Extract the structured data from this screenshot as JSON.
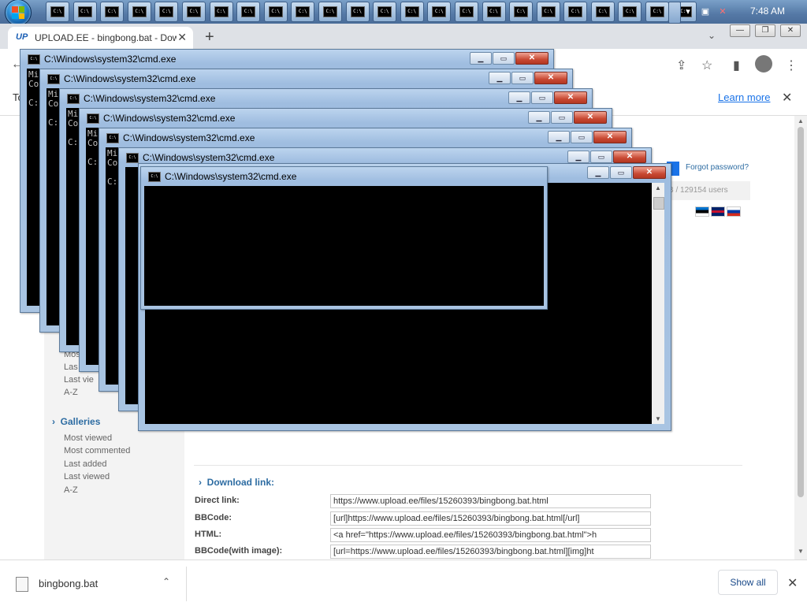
{
  "taskbar": {
    "button_count": 24,
    "cmd_icon_label": "C:\\",
    "clock": "7:48 AM"
  },
  "browser": {
    "tab_title": "UPLOAD.EE - bingbong.bat - Dow",
    "tab_favicon": "UP",
    "new_tab": "+",
    "infobar_lead": "To",
    "learn_more": "Learn more"
  },
  "site": {
    "forgot_password": "Forgot password?",
    "stats": "B  /  129154 users",
    "sidebar_links_top": [
      "Mos",
      "Las",
      "Last vie",
      "A-Z"
    ],
    "galleries": "Galleries",
    "gallery_links": [
      "Most viewed",
      "Most commented",
      "Last added",
      "Last viewed",
      "A-Z"
    ],
    "download_link_title": "Download link:",
    "links": [
      {
        "label": "Direct link:",
        "value": "https://www.upload.ee/files/15260393/bingbong.bat.html"
      },
      {
        "label": "BBCode:",
        "value": "[url]https://www.upload.ee/files/15260393/bingbong.bat.html[/url]"
      },
      {
        "label": "HTML:",
        "value": "<a href=\"https://www.upload.ee/files/15260393/bingbong.bat.html\">h"
      },
      {
        "label": "BBCode(with image):",
        "value": "[url=https://www.upload.ee/files/15260393/bingbong.bat.html][img]ht"
      }
    ]
  },
  "cmd": {
    "title": "C:\\Windows\\system32\\cmd.exe",
    "line1": "Mi",
    "line2": "Co",
    "prompt": "C:"
  },
  "download_shelf": {
    "filename": "bingbong.bat",
    "show_all": "Show all"
  }
}
